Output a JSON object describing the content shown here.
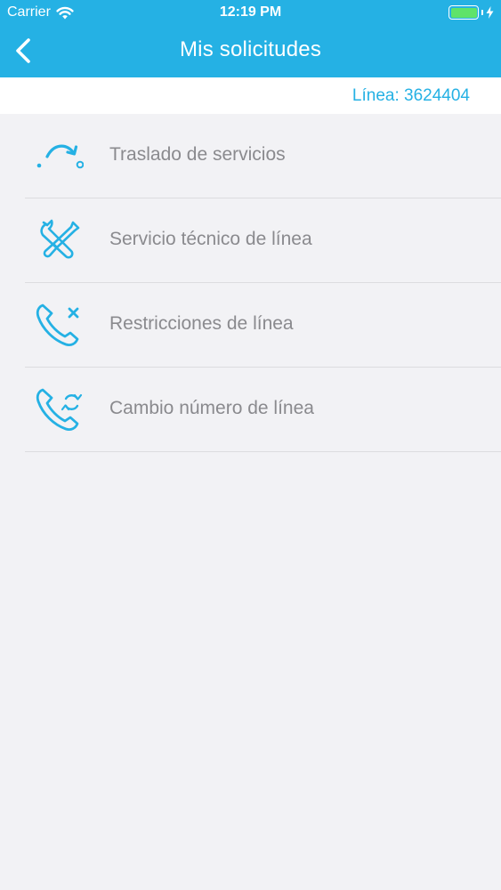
{
  "status_bar": {
    "carrier": "Carrier",
    "time": "12:19 PM",
    "battery_level": 1.0
  },
  "navbar": {
    "title": "Mis solicitudes",
    "back_icon": "chevron-left-icon"
  },
  "line": {
    "label": "Línea: 3624404"
  },
  "menu": {
    "items": [
      {
        "label": "Traslado de servicios",
        "icon": "transfer-arrow-icon"
      },
      {
        "label": "Servicio técnico de línea",
        "icon": "wrench-screwdriver-icon"
      },
      {
        "label": "Restricciones de línea",
        "icon": "phone-x-icon"
      },
      {
        "label": "Cambio número de línea",
        "icon": "phone-swap-icon"
      }
    ]
  },
  "colors": {
    "brand": "#25b1e4",
    "label_gray": "#8a8a8e",
    "background": "#f2f2f5",
    "battery_green": "#5fe36a"
  }
}
